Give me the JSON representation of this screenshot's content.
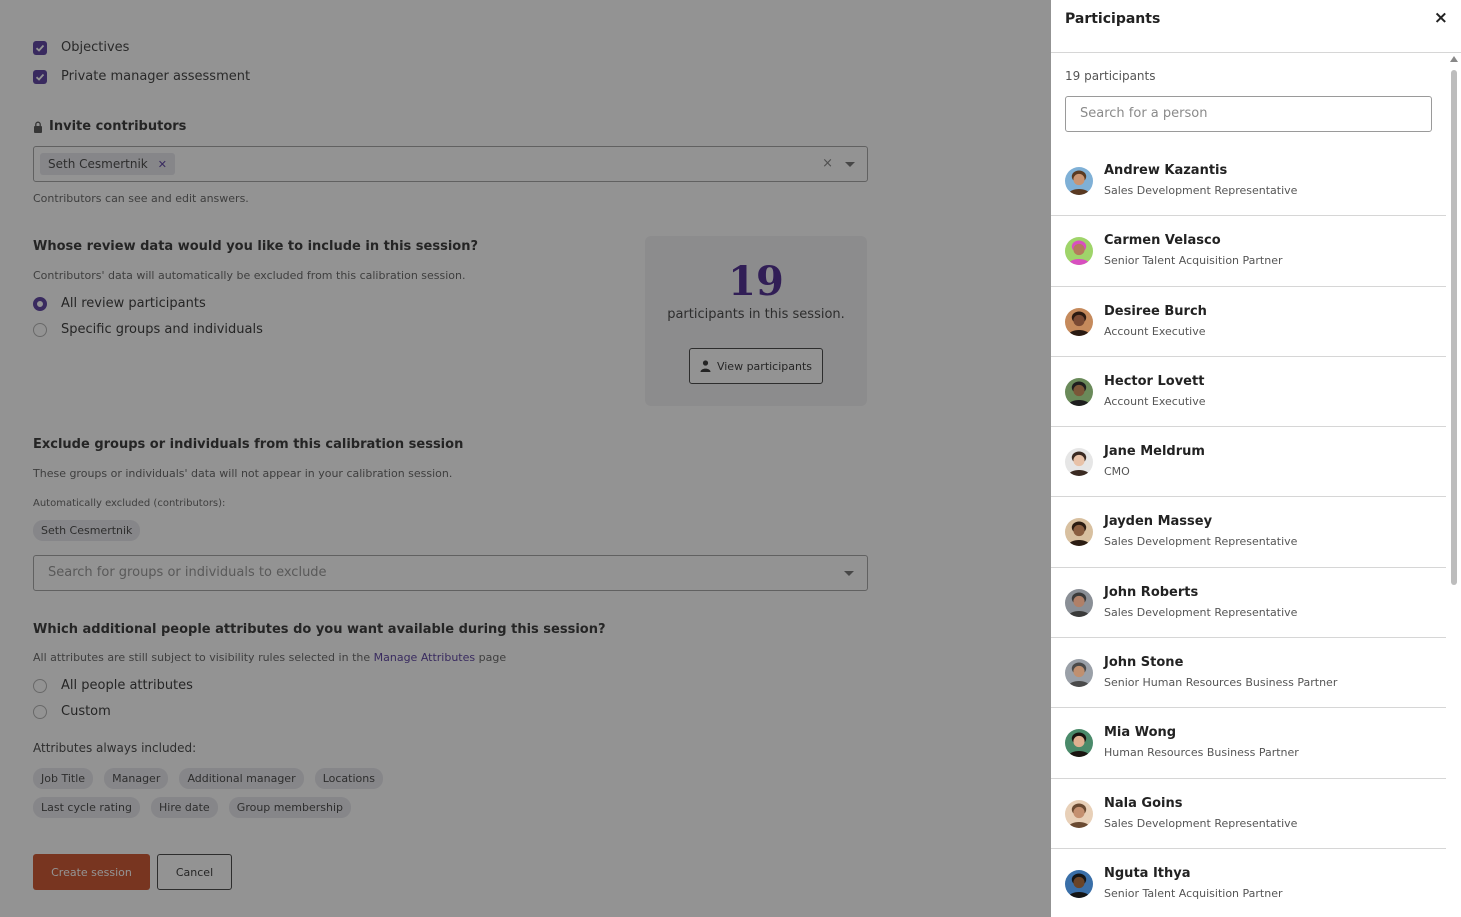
{
  "form": {
    "checkboxes": [
      {
        "label": "Objectives",
        "checked": true
      },
      {
        "label": "Private manager assessment",
        "checked": true
      }
    ],
    "invite": {
      "label": "Invite contributors",
      "chip": "Seth Cesmertnik",
      "clear_symbol": "×",
      "help": "Contributors can see and edit answers."
    },
    "review_data": {
      "question": "Whose review data would you like to include in this session?",
      "help": "Contributors' data will automatically be excluded from this calibration session.",
      "options": [
        {
          "label": "All review participants",
          "selected": true
        },
        {
          "label": "Specific groups and individuals",
          "selected": false
        }
      ]
    },
    "count_card": {
      "number": "19",
      "text": "participants in this session.",
      "button": "View participants"
    },
    "exclude": {
      "title": "Exclude groups or individuals from this calibration session",
      "help": "These groups or individuals' data will not appear in your calibration session.",
      "auto_label": "Automatically excluded (contributors):",
      "auto_tag": "Seth Cesmertnik",
      "search_placeholder": "Search for groups or individuals to exclude"
    },
    "attributes": {
      "question": "Which additional people attributes do you want available during this session?",
      "help_prefix": "All attributes are still subject to visibility rules selected in the ",
      "help_link": "Manage Attributes",
      "help_suffix": " page",
      "options": [
        {
          "label": "All people attributes",
          "selected": false
        },
        {
          "label": "Custom",
          "selected": false
        }
      ],
      "always_label": "Attributes always included:",
      "tags_row1": [
        "Job Title",
        "Manager",
        "Additional manager",
        "Locations"
      ],
      "tags_row2": [
        "Last cycle rating",
        "Hire date",
        "Group membership"
      ]
    },
    "buttons": {
      "create": "Create session",
      "cancel": "Cancel"
    }
  },
  "panel": {
    "title": "Participants",
    "close": "×",
    "count": "19 participants",
    "search_placeholder": "Search for a person",
    "people": [
      {
        "name": "Andrew Kazantis",
        "title": "Sales Development Representative",
        "skin": "#c99472",
        "hair": "#5a3a22",
        "bg": "#7fb0d6"
      },
      {
        "name": "Carmen Velasco",
        "title": "Senior Talent Acquisition Partner",
        "skin": "#b47b5c",
        "hair": "#d84fc0",
        "bg": "#9fd46a"
      },
      {
        "name": "Desiree Burch",
        "title": "Account Executive",
        "skin": "#7a4a34",
        "hair": "#2a1a12",
        "bg": "#c58a5c"
      },
      {
        "name": "Hector Lovett",
        "title": "Account Executive",
        "skin": "#7b5638",
        "hair": "#1e1e1e",
        "bg": "#6a8a5a"
      },
      {
        "name": "Jane Meldrum",
        "title": "CMO",
        "skin": "#e8c2a8",
        "hair": "#3a2a22",
        "bg": "#e6e6e6"
      },
      {
        "name": "Jayden Massey",
        "title": "Sales Development Representative",
        "skin": "#8a5e40",
        "hair": "#2b1c12",
        "bg": "#d8c0a0"
      },
      {
        "name": "John Roberts",
        "title": "Sales Development Representative",
        "skin": "#b08068",
        "hair": "#3a3a3a",
        "bg": "#8a8f96"
      },
      {
        "name": "John Stone",
        "title": "Senior Human Resources Business Partner",
        "skin": "#c09070",
        "hair": "#4a4a4a",
        "bg": "#9aa0a8"
      },
      {
        "name": "Mia Wong",
        "title": "Human Resources Business Partner",
        "skin": "#e0b090",
        "hair": "#1a1410",
        "bg": "#4a8a6a"
      },
      {
        "name": "Nala Goins",
        "title": "Sales Development Representative",
        "skin": "#c49070",
        "hair": "#6a4a32",
        "bg": "#e8d0b8"
      },
      {
        "name": "Nguta Ithya",
        "title": "Senior Talent Acquisition Partner",
        "skin": "#6a4428",
        "hair": "#151515",
        "bg": "#3a6fa8"
      }
    ]
  }
}
